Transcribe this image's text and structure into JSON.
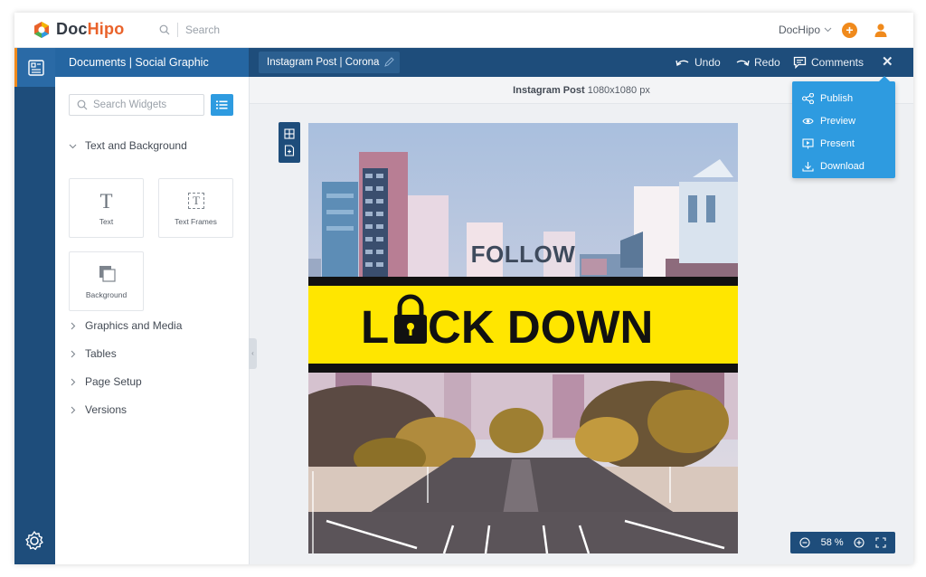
{
  "app": {
    "logo_text_a": "Doc",
    "logo_text_b": "Hipo",
    "search_placeholder": "Search",
    "account_label": "DocHipo",
    "add_symbol": "+"
  },
  "toolbar": {
    "panel_title": "Documents | Social Graphic",
    "doc_name": "Instagram Post | Corona",
    "undo": "Undo",
    "redo": "Redo",
    "comments": "Comments",
    "close": "✕"
  },
  "menu": {
    "items": [
      {
        "label": "Publish",
        "icon": "share-icon"
      },
      {
        "label": "Preview",
        "icon": "eye-icon"
      },
      {
        "label": "Present",
        "icon": "present-icon"
      },
      {
        "label": "Download",
        "icon": "download-icon"
      }
    ]
  },
  "panel": {
    "search_placeholder": "Search Widgets",
    "text_section": "Text and Background",
    "tiles": [
      "Text",
      "Text Frames",
      "Background"
    ],
    "sections": [
      "Graphics and Media",
      "Tables",
      "Page Setup",
      "Versions"
    ]
  },
  "canvas": {
    "header_bold": "Instagram Post",
    "header_size": "1080x1080 px",
    "zoom_value": "58",
    "zoom_unit": "%"
  },
  "poster": {
    "line1": "FOLLOW",
    "line2_a": "L",
    "line2_b": "CK DOWN",
    "band_color": "#ffe600"
  },
  "colors": {
    "brand_dark": "#1e4d7b",
    "brand_blue": "#2e9be0",
    "accent_orange": "#f08a1c"
  }
}
